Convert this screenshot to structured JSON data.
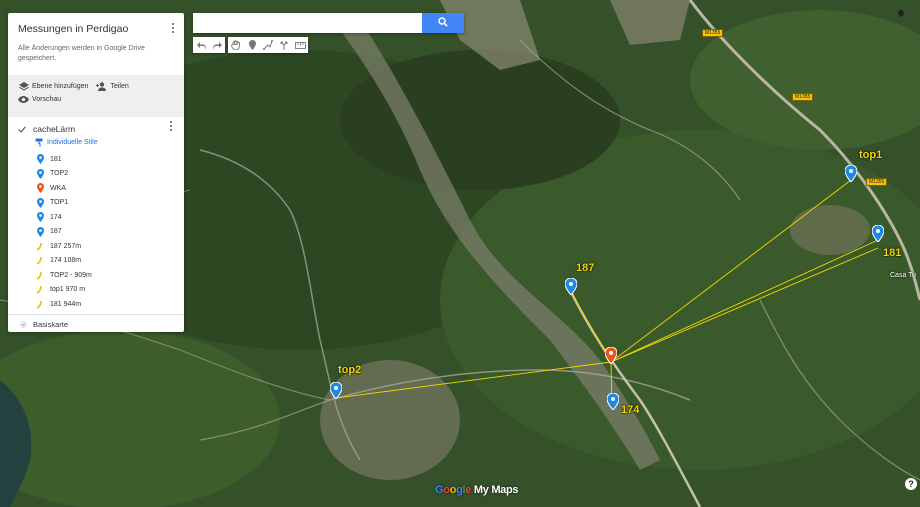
{
  "panel": {
    "title": "Messungen in Perdigao",
    "save_note": "Alle Änderungen werden in Google Drive gespeichert.",
    "actions": {
      "add_layer": "Ebene hinzufügen",
      "share": "Teilen",
      "preview": "Vorschau"
    },
    "layer": {
      "name": "cacheLärm",
      "style_link": "Individuelle Stile",
      "items": [
        {
          "label": "181",
          "icon": "blue-pin-icon"
        },
        {
          "label": "TOP2",
          "icon": "blue-pin-icon"
        },
        {
          "label": "WKA",
          "icon": "orange-pin-icon"
        },
        {
          "label": "TOP1",
          "icon": "blue-pin-icon"
        },
        {
          "label": "174",
          "icon": "blue-pin-icon"
        },
        {
          "label": "187",
          "icon": "blue-pin-icon"
        },
        {
          "label": "187 257m",
          "icon": "line-icon"
        },
        {
          "label": "174 108m",
          "icon": "line-icon"
        },
        {
          "label": "TOP2 - 909m",
          "icon": "line-icon"
        },
        {
          "label": "top1 970 m",
          "icon": "line-icon"
        },
        {
          "label": "181 944m",
          "icon": "line-icon"
        }
      ]
    },
    "basemap": "Basiskarte"
  },
  "search": {
    "placeholder": ""
  },
  "toolbar": {
    "tools": [
      "undo-icon",
      "redo-icon",
      "hand-icon",
      "marker-icon",
      "draw-line-icon",
      "directions-icon",
      "ruler-icon"
    ]
  },
  "map": {
    "markers": {
      "top1": "top1",
      "n181": "181",
      "n187": "187",
      "top2": "top2",
      "n174": "174"
    },
    "road_labels": [
      "M1355",
      "M1355",
      "M1355"
    ],
    "place_label": "Casa Tu",
    "logo": {
      "g1": "G",
      "g2": "o",
      "g3": "o",
      "g4": "g",
      "g5": "l",
      "g6": "e",
      "rest": " My Maps"
    },
    "help": "?"
  },
  "colors": {
    "blue_marker": "#1e88e5",
    "orange_marker": "#e8561e",
    "measure_line": "#f2d700",
    "search_button": "#4285f4"
  }
}
